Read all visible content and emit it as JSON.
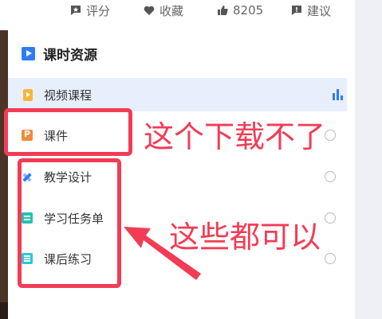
{
  "toolbar": {
    "rate_label": "评分",
    "favorite_label": "收藏",
    "like_count": "8205",
    "suggest_label": "建议"
  },
  "resources": {
    "title": "课时资源",
    "video_course_label": "视频课程",
    "items": [
      {
        "label": "课件",
        "icon": "slides-icon"
      },
      {
        "label": "教学设计",
        "icon": "design-icon"
      },
      {
        "label": "学习任务单",
        "icon": "clipboard-icon"
      },
      {
        "label": "课后练习",
        "icon": "exercise-icon"
      }
    ]
  },
  "annotations": {
    "cannot_download": "这个下载不了",
    "all_ok": "这些都可以"
  },
  "colors": {
    "accent": "#2f7cf6",
    "annotation": "#f23c55",
    "video_row_bg": "#e8effc"
  }
}
